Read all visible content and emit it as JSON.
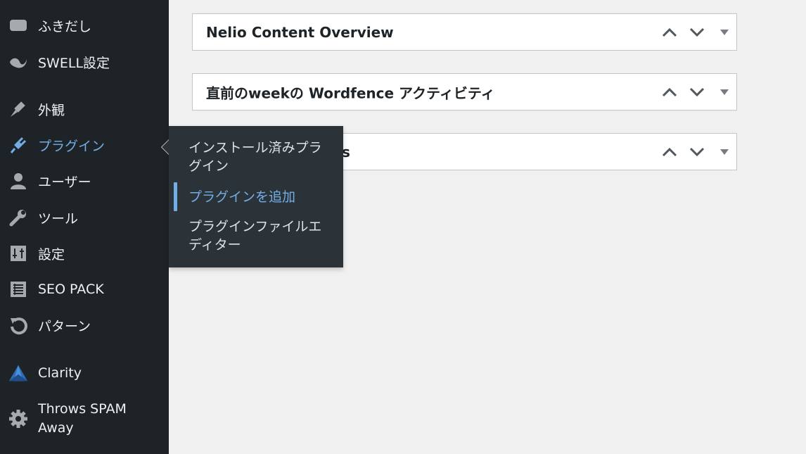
{
  "sidebar": {
    "items": [
      {
        "id": "fukidashi",
        "label": "ふきだし",
        "icon": "speech-bubble-icon"
      },
      {
        "id": "swell",
        "label": "SWELL設定",
        "icon": "swell-icon"
      },
      {
        "id": "appearance",
        "label": "外観",
        "icon": "paint-brush-icon"
      },
      {
        "id": "plugins",
        "label": "プラグイン",
        "icon": "plugin-icon",
        "active": true
      },
      {
        "id": "users",
        "label": "ユーザー",
        "icon": "user-icon"
      },
      {
        "id": "tools",
        "label": "ツール",
        "icon": "wrench-icon"
      },
      {
        "id": "settings",
        "label": "設定",
        "icon": "sliders-icon"
      },
      {
        "id": "seo-pack",
        "label": "SEO PACK",
        "icon": "list-icon"
      },
      {
        "id": "patterns",
        "label": "パターン",
        "icon": "undo-icon"
      },
      {
        "id": "clarity",
        "label": "Clarity",
        "icon": "clarity-icon"
      },
      {
        "id": "throws-spam",
        "label": "Throws SPAM Away",
        "icon": "gear-icon"
      }
    ]
  },
  "submenu": {
    "items": [
      {
        "label": "インストール済みプラグイン"
      },
      {
        "label": "プラグインを追加",
        "current": true
      },
      {
        "label": "プラグインファイルエディター"
      }
    ]
  },
  "postboxes": [
    {
      "title": "Nelio Content Overview"
    },
    {
      "title": "直前のweekの Wordfence アクティビティ"
    },
    {
      "title": "s"
    }
  ],
  "colors": {
    "sidebar_bg": "#1d2327",
    "flyout_bg": "#2c3338",
    "accent": "#72aee6",
    "page_bg": "#f0f0f1"
  }
}
